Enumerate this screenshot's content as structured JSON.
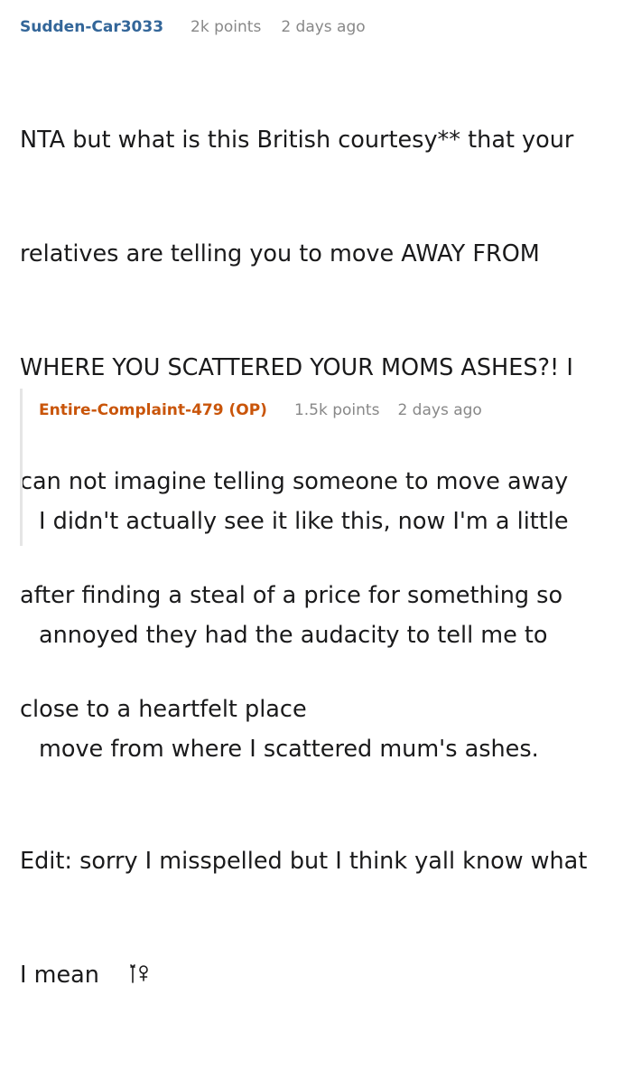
{
  "top_comment": {
    "author": "Sudden-Car3033",
    "points": "2k points",
    "time": "2 days ago",
    "body_lines": [
      "NTA but what is this British courtesy** that your",
      "relatives are telling you to move AWAY FROM",
      "WHERE YOU SCATTERED YOUR MOMS ASHES?! I",
      "can not imagine telling someone to move away",
      "after finding a steal of a price for something so",
      "close to a heartfelt place"
    ],
    "edit_lines": [
      "Edit: sorry I misspelled but I think yall know what",
      "I mean"
    ],
    "emoji_icon": "person-shrugging-icon"
  },
  "reply": {
    "author": "Entire-Complaint-479 (OP)",
    "points": "1.5k points",
    "time": "2 days ago",
    "body_lines": [
      "I didn't actually see it like this, now I'm a little",
      "annoyed they had the audacity to tell me to",
      "move from where I scattered mum's ashes."
    ]
  },
  "colors": {
    "top_author": "#336699",
    "op_author": "#c9550a",
    "meta_text": "#888888",
    "body_text": "#1a1a1b",
    "thread_line": "#e5e5e5"
  }
}
